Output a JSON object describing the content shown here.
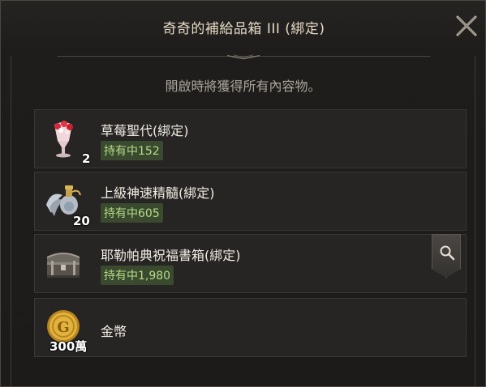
{
  "window": {
    "title": "奇奇的補給品箱 III (綁定)",
    "close_icon": "close-x-icon"
  },
  "subtitle": "開啟時將獲得所有內容物。",
  "items": [
    {
      "name": "草莓聖代(綁定)",
      "owned": "持有中152",
      "qty": "2",
      "icon": "strawberry-parfait-icon"
    },
    {
      "name": "上級神速精髓(綁定)",
      "owned": "持有中605",
      "qty": "20",
      "icon": "winged-potion-icon"
    },
    {
      "name": "耶勒帕典祝福書箱(綁定)",
      "owned": "持有中1,980",
      "qty": "",
      "icon": "treasure-chest-icon",
      "has_search": true
    },
    {
      "name": "金幣",
      "owned": "",
      "qty": "300萬",
      "icon": "gold-coin-icon"
    }
  ],
  "colors": {
    "owned_bg": "#3a4a2e",
    "owned_text": "#b6d98a",
    "gold": "#d9a93a"
  }
}
